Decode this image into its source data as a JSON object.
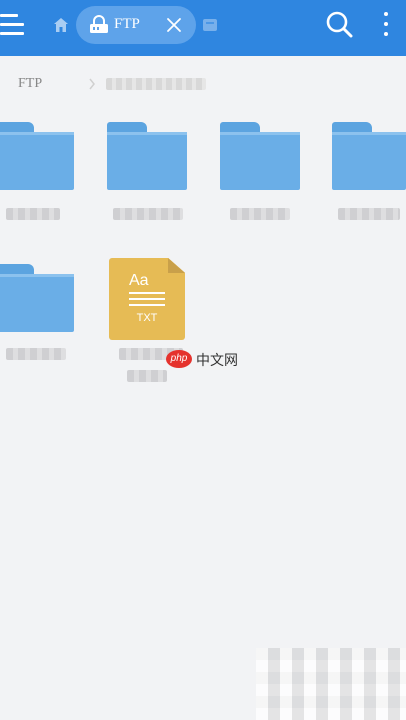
{
  "colors": {
    "app_bar": "#2f86e0",
    "active_tab": "#5ea3ea",
    "folder": "#6aaee7",
    "txt_file": "#e6bb55",
    "background": "#f2f3f5"
  },
  "app_bar": {
    "icons": [
      "menu-icon",
      "home-icon",
      "ftp-tab-icon",
      "close-icon",
      "tab-next-icon",
      "search-icon",
      "more-vertical-icon"
    ],
    "active_tab": {
      "label": "FTP"
    }
  },
  "breadcrumb": {
    "root": "FTP"
  },
  "files": {
    "items": [
      {
        "type": "folder"
      },
      {
        "type": "folder"
      },
      {
        "type": "folder"
      },
      {
        "type": "folder"
      },
      {
        "type": "folder"
      },
      {
        "type": "txt",
        "icon_letters": "Aa",
        "icon_ext": "TXT"
      }
    ]
  },
  "watermark": {
    "logo": "php",
    "text": "中文网"
  }
}
